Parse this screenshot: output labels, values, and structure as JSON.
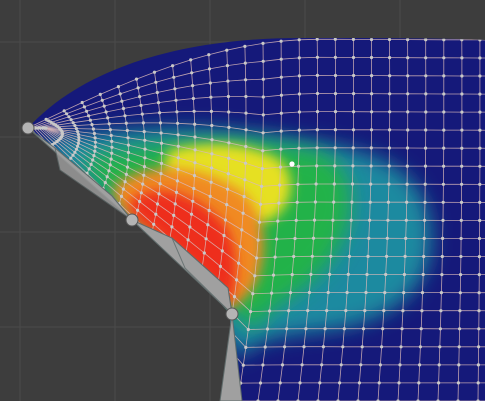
{
  "viewport": {
    "background": "#3d3d3d",
    "grid_color": "#4a4a4a",
    "mode": "weight-paint"
  },
  "mesh": {
    "base_color": "#15197a",
    "wire_color": "#d9b8b8",
    "vertex_color": "#c9c9c9",
    "active_vertex_color": "#ffffff",
    "weight_gradient": [
      "#15197a",
      "#1f8aa0",
      "#22b24a",
      "#e6e020",
      "#f08a20",
      "#ee2f1c"
    ]
  },
  "armature": {
    "bone_color": "#a0a0a0",
    "bone_outline": "#5f6b6b",
    "joint_color": "#b4b4b4",
    "bones": [
      "bone-1",
      "bone-2",
      "bone-3"
    ]
  }
}
